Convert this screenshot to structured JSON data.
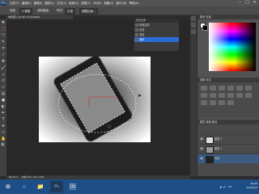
{
  "app": {
    "logo": "Ps",
    "window_controls": [
      "–",
      "□",
      "✕"
    ]
  },
  "menu": [
    "文件(F)",
    "编辑(E)",
    "图像(I)",
    "图层(L)",
    "文字(Y)",
    "选择(S)",
    "滤镜(T)",
    "3D(D)",
    "视图(V)",
    "窗口(W)",
    "帮助(H)"
  ],
  "options_bar": {
    "feather_label": "羽化:",
    "feather_value": "0 像素",
    "antialias_label": "消除锯齿",
    "style_label": "样式:",
    "style_value": "正常",
    "refine_button": "调整边缘..."
  },
  "document": {
    "tab_title": "未标题-1 @ 66.7% (RGB/8)",
    "status_zoom": "66.67%",
    "status_doc": "文档:452.1K/1.19M"
  },
  "history": {
    "title": "历史记录",
    "items": [
      "快速选择",
      "加选",
      "减选",
      "羽化"
    ]
  },
  "color_panel": {
    "title": "颜色  色板"
  },
  "adjustments": {
    "title": "调整  样式"
  },
  "layers": {
    "title": "图层  通道  路径",
    "items": [
      {
        "name": "图层 2",
        "eye": "👁"
      },
      {
        "name": "图层 1",
        "eye": "👁"
      },
      {
        "name": "背景",
        "eye": "👁"
      }
    ]
  },
  "taskbar": {
    "apps": [
      "⊞",
      "e",
      "📁",
      "Ps",
      "🖼"
    ],
    "tray": [
      "▲",
      "🔊",
      "CH"
    ],
    "time": "22:05",
    "date": "2015/1/5"
  },
  "colors": {
    "selection": "#2a6bd5",
    "taskbar": "#1e4e86",
    "annotation": "#e02020"
  }
}
